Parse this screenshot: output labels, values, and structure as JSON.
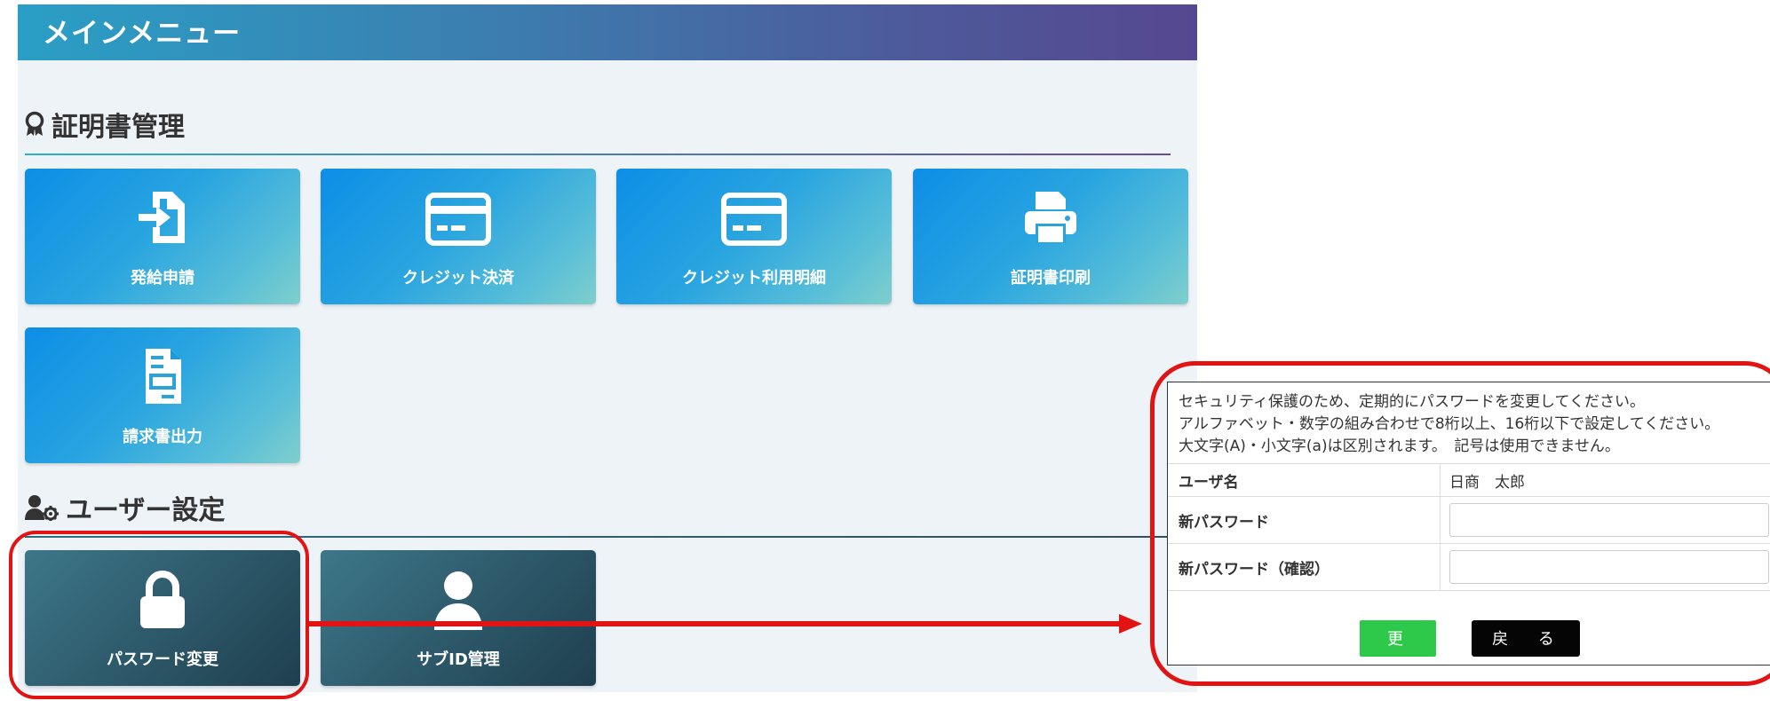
{
  "main_menu": {
    "title": "メインメニュー"
  },
  "certificate_section": {
    "title": "証明書管理",
    "tiles": [
      {
        "label": "発給申請",
        "icon": "sign-in-icon"
      },
      {
        "label": "クレジット決済",
        "icon": "credit-card-icon"
      },
      {
        "label": "クレジット利用明細",
        "icon": "credit-card-icon"
      },
      {
        "label": "証明書印刷",
        "icon": "printer-icon"
      },
      {
        "label": "請求書出力",
        "icon": "document-icon"
      }
    ]
  },
  "user_section": {
    "title": "ユーザー設定",
    "tiles": [
      {
        "label": "パスワード変更",
        "icon": "lock-icon"
      },
      {
        "label": "サブID管理",
        "icon": "user-icon"
      }
    ]
  },
  "password_form": {
    "instructions": [
      "セキュリティ保護のため、定期的にパスワードを変更してください。",
      "アルファベット・数字の組み合わせで8桁以上、16桁以下で設定してください。",
      "大文字(A)・小文字(a)は区別されます。　記号は使用できません。"
    ],
    "username_label": "ユーザ名",
    "username_value": "日商　太郎",
    "new_password_label": "新パスワード",
    "new_password_value": "",
    "confirm_password_label": "新パスワード（確認）",
    "confirm_password_value": "",
    "update_button": "更 新",
    "back_button": "戻 る"
  },
  "colors": {
    "header_gradient_start": "#2a9fc6",
    "header_gradient_end": "#564890",
    "annotation_red": "#e21313",
    "update_green": "#2ec94a"
  }
}
